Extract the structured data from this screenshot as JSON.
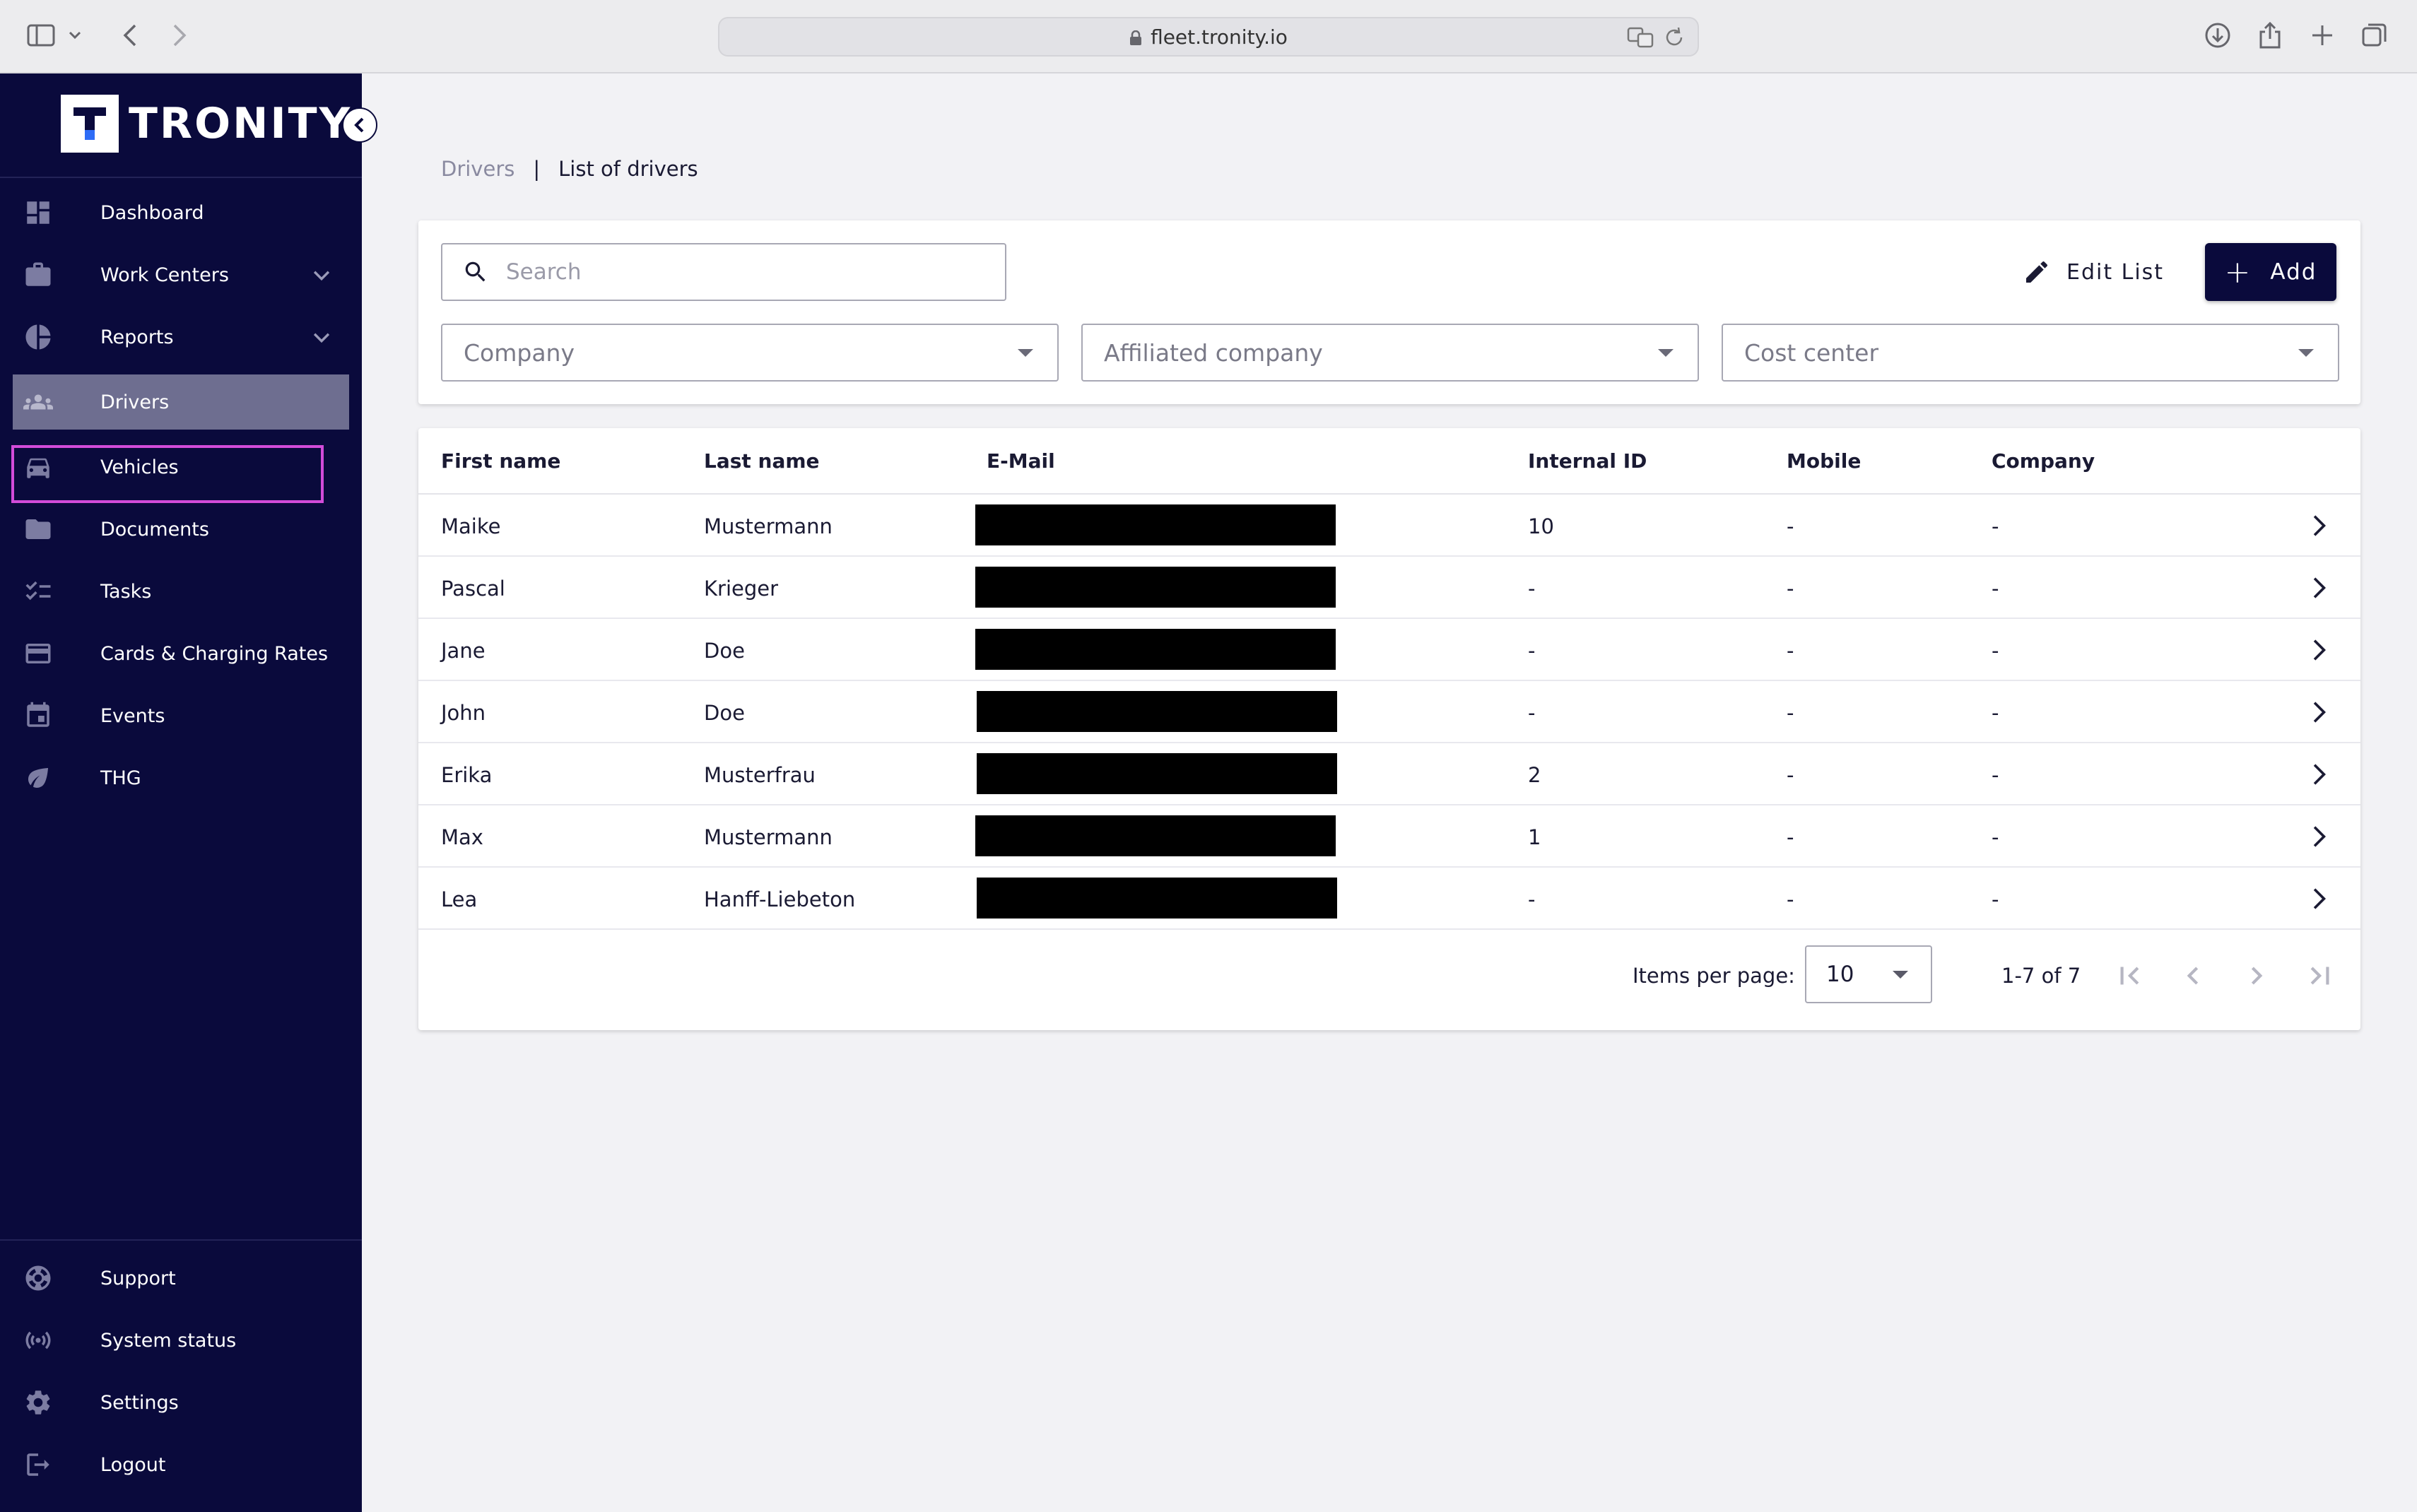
{
  "browser": {
    "url": "fleet.tronity.io"
  },
  "brand": {
    "name": "TRONITY"
  },
  "sidebar": {
    "items": [
      {
        "label": "Dashboard",
        "icon": "dashboard-icon"
      },
      {
        "label": "Work Centers",
        "icon": "briefcase-icon",
        "expandable": true
      },
      {
        "label": "Reports",
        "icon": "pie-chart-icon",
        "expandable": true
      },
      {
        "label": "Drivers",
        "icon": "people-icon",
        "active": true
      },
      {
        "label": "Vehicles",
        "icon": "car-icon"
      },
      {
        "label": "Documents",
        "icon": "folder-icon"
      },
      {
        "label": "Tasks",
        "icon": "checklist-icon"
      },
      {
        "label": "Cards & Charging Rates",
        "icon": "credit-card-icon"
      },
      {
        "label": "Events",
        "icon": "calendar-icon"
      },
      {
        "label": "THG",
        "icon": "leaf-icon"
      }
    ],
    "bottom_items": [
      {
        "label": "Support",
        "icon": "lifebuoy-icon"
      },
      {
        "label": "System status",
        "icon": "broadcast-icon"
      },
      {
        "label": "Settings",
        "icon": "gear-icon"
      },
      {
        "label": "Logout",
        "icon": "logout-icon"
      }
    ]
  },
  "breadcrumb": {
    "parent": "Drivers",
    "separator": "|",
    "current": "List of drivers"
  },
  "filters": {
    "search_placeholder": "Search",
    "edit_list_label": "Edit List",
    "add_label": "Add",
    "company_placeholder": "Company",
    "affiliated_placeholder": "Affiliated company",
    "cost_center_placeholder": "Cost center"
  },
  "table": {
    "columns": [
      "First name",
      "Last name",
      "E-Mail",
      "Internal ID",
      "Mobile",
      "Company"
    ],
    "rows": [
      {
        "first": "Maike",
        "last": "Mustermann",
        "internal_id": "10",
        "mobile": "-",
        "company": "-"
      },
      {
        "first": "Pascal",
        "last": "Krieger",
        "internal_id": "-",
        "mobile": "-",
        "company": "-"
      },
      {
        "first": "Jane",
        "last": "Doe",
        "internal_id": "-",
        "mobile": "-",
        "company": "-"
      },
      {
        "first": "John",
        "last": "Doe",
        "internal_id": "-",
        "mobile": "-",
        "company": "-"
      },
      {
        "first": "Erika",
        "last": "Musterfrau",
        "internal_id": "2",
        "mobile": "-",
        "company": "-"
      },
      {
        "first": "Max",
        "last": "Mustermann",
        "internal_id": "1",
        "mobile": "-",
        "company": "-"
      },
      {
        "first": "Lea",
        "last": "Hanff-Liebeton",
        "internal_id": "-",
        "mobile": "-",
        "company": "-"
      }
    ]
  },
  "paginator": {
    "items_per_page_label": "Items per page:",
    "items_per_page": "10",
    "range_label": "1-7 of 7"
  },
  "colors": {
    "sidebar_bg": "#0a0a3c",
    "active_item_bg": "#6e6e90",
    "active_outline": "#d24cd9",
    "primary_button": "#0a0a3c"
  }
}
